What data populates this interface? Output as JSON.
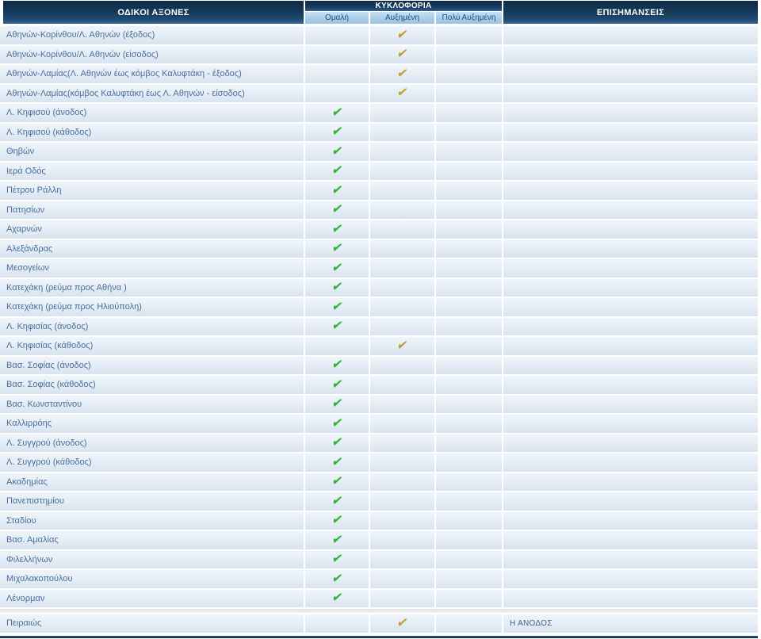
{
  "table": {
    "headers": {
      "axes": "ΟΔΙΚΟΙ ΑΞΟΝΕΣ",
      "traffic": "ΚΥΚΛΟΦΟΡΙΑ",
      "remarks": "ΕΠΙΣΗΜΑΝΣΕΙΣ",
      "levels": [
        "Ομαλή",
        "Αυξημένη",
        "Πολύ Αυξημένη"
      ]
    },
    "check_glyph": "✔",
    "colors": {
      "normal_check": "#2cb32c",
      "increased_check": "#c59d2b",
      "header_navy_top": "#0e2c4a",
      "header_navy_bottom": "#356694",
      "subheader_blue": "#a8cce8",
      "row_text": "#4a6e9c"
    },
    "rows": [
      {
        "name": "Αθηνών-Κορίνθου/Λ. Αθηνών (έξοδος)",
        "level": "increased",
        "remark": ""
      },
      {
        "name": "Αθηνών-Κορίνθου/Λ. Αθηνών (είσοδος)",
        "level": "increased",
        "remark": ""
      },
      {
        "name": "Αθηνών-Λαμίας(Λ. Αθηνών έως κόμβος Καλυφτάκη - έξοδος)",
        "level": "increased",
        "remark": ""
      },
      {
        "name": "Αθηνών-Λαμίας(κόμβος Καλυφτάκη έως Λ. Αθηνών - είσοδος)",
        "level": "increased",
        "remark": ""
      },
      {
        "name": "Λ. Κηφισού (άνοδος)",
        "level": "normal",
        "remark": ""
      },
      {
        "name": "Λ. Κηφισού (κάθοδος)",
        "level": "normal",
        "remark": ""
      },
      {
        "name": "Θηβών",
        "level": "normal",
        "remark": ""
      },
      {
        "name": "Ιερά Οδός",
        "level": "normal",
        "remark": ""
      },
      {
        "name": "Πέτρου Ράλλη",
        "level": "normal",
        "remark": ""
      },
      {
        "name": "Πατησίων",
        "level": "normal",
        "remark": ""
      },
      {
        "name": "Αχαρνών",
        "level": "normal",
        "remark": ""
      },
      {
        "name": "Αλεξάνδρας",
        "level": "normal",
        "remark": ""
      },
      {
        "name": "Μεσογείων",
        "level": "normal",
        "remark": ""
      },
      {
        "name": "Κατεχάκη (ρεύμα προς Αθήνα )",
        "level": "normal",
        "remark": ""
      },
      {
        "name": "Κατεχάκη (ρεύμα προς Ηλιούπολη)",
        "level": "normal",
        "remark": ""
      },
      {
        "name": "Λ. Κηφισίας (άνοδος)",
        "level": "normal",
        "remark": ""
      },
      {
        "name": "Λ. Κηφισίας (κάθοδος)",
        "level": "increased",
        "remark": ""
      },
      {
        "name": "Βασ. Σοφίας (άνοδος)",
        "level": "normal",
        "remark": ""
      },
      {
        "name": "Βασ. Σοφίας (κάθοδος)",
        "level": "normal",
        "remark": ""
      },
      {
        "name": "Βασ. Κωνσταντίνου",
        "level": "normal",
        "remark": ""
      },
      {
        "name": "Καλλιρρόης",
        "level": "normal",
        "remark": ""
      },
      {
        "name": "Λ. Συγγρού (άνοδος)",
        "level": "normal",
        "remark": ""
      },
      {
        "name": "Λ. Συγγρού (κάθοδος)",
        "level": "normal",
        "remark": ""
      },
      {
        "name": "Ακαδημίας",
        "level": "normal",
        "remark": ""
      },
      {
        "name": "Πανεπιστημίου",
        "level": "normal",
        "remark": ""
      },
      {
        "name": "Σταδίου",
        "level": "normal",
        "remark": ""
      },
      {
        "name": "Βασ. Αμαλίας",
        "level": "normal",
        "remark": ""
      },
      {
        "name": "Φιλελλήνων",
        "level": "normal",
        "remark": ""
      },
      {
        "name": "Μιχαλακοπούλου",
        "level": "normal",
        "remark": ""
      },
      {
        "name": "Λένορμαν",
        "level": "normal",
        "remark": ""
      },
      {
        "name": "Πειραιώς",
        "level": "increased",
        "remark": "Η ΑΝΟΔΟΣ",
        "separated": true
      }
    ]
  }
}
